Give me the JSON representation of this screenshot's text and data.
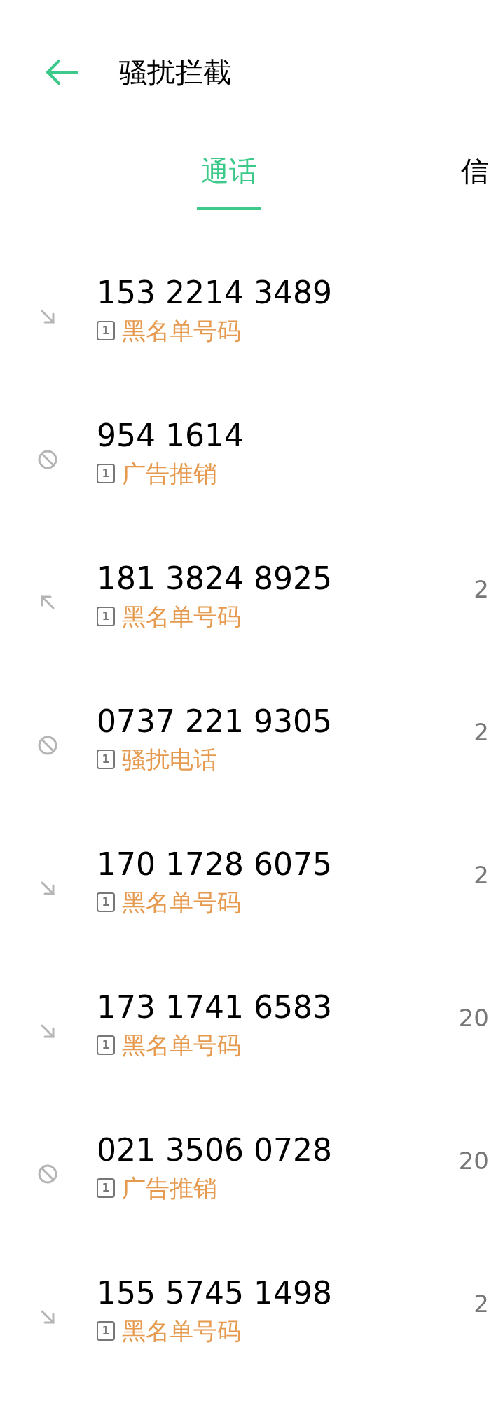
{
  "header": {
    "title": "骚扰拦截"
  },
  "tabs": [
    {
      "label": "通话",
      "selected": true
    },
    {
      "label": "信",
      "selected": false
    }
  ],
  "calls": [
    {
      "number": "153 2214 3489",
      "kind": "incoming",
      "sim": "1",
      "tag": "黑名单号码"
    },
    {
      "number": "954 1614",
      "kind": "blocked",
      "sim": "1",
      "tag": "广告推销"
    },
    {
      "number": "181 3824 8925",
      "kind": "outgoing",
      "sim": "1",
      "tag": "黑名单号码",
      "date": "2"
    },
    {
      "number": "0737 221 9305",
      "kind": "blocked",
      "sim": "1",
      "tag": "骚扰电话",
      "date": "2"
    },
    {
      "number": "170 1728 6075",
      "kind": "incoming",
      "sim": "1",
      "tag": "黑名单号码",
      "date": "2"
    },
    {
      "number": "173 1741 6583",
      "kind": "incoming",
      "sim": "1",
      "tag": "黑名单号码",
      "date": "20"
    },
    {
      "number": "021 3506 0728",
      "kind": "blocked",
      "sim": "1",
      "tag": "广告推销",
      "date": "20"
    },
    {
      "number": "155 5745 1498",
      "kind": "incoming",
      "sim": "1",
      "tag": "黑名单号码",
      "date": "2"
    }
  ]
}
